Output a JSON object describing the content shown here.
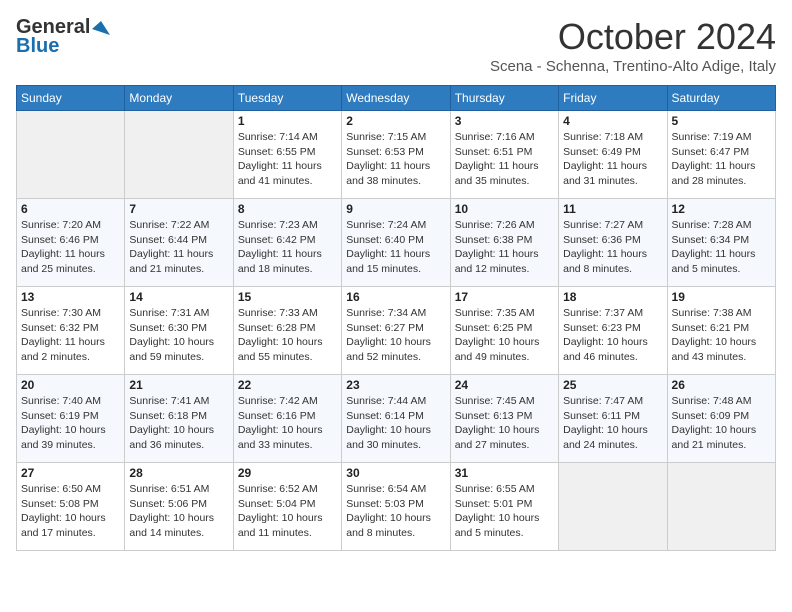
{
  "header": {
    "logo_general": "General",
    "logo_blue": "Blue",
    "month_title": "October 2024",
    "location": "Scena - Schenna, Trentino-Alto Adige, Italy"
  },
  "weekdays": [
    "Sunday",
    "Monday",
    "Tuesday",
    "Wednesday",
    "Thursday",
    "Friday",
    "Saturday"
  ],
  "weeks": [
    [
      {
        "day": "",
        "info": ""
      },
      {
        "day": "",
        "info": ""
      },
      {
        "day": "1",
        "info": "Sunrise: 7:14 AM\nSunset: 6:55 PM\nDaylight: 11 hours and 41 minutes."
      },
      {
        "day": "2",
        "info": "Sunrise: 7:15 AM\nSunset: 6:53 PM\nDaylight: 11 hours and 38 minutes."
      },
      {
        "day": "3",
        "info": "Sunrise: 7:16 AM\nSunset: 6:51 PM\nDaylight: 11 hours and 35 minutes."
      },
      {
        "day": "4",
        "info": "Sunrise: 7:18 AM\nSunset: 6:49 PM\nDaylight: 11 hours and 31 minutes."
      },
      {
        "day": "5",
        "info": "Sunrise: 7:19 AM\nSunset: 6:47 PM\nDaylight: 11 hours and 28 minutes."
      }
    ],
    [
      {
        "day": "6",
        "info": "Sunrise: 7:20 AM\nSunset: 6:46 PM\nDaylight: 11 hours and 25 minutes."
      },
      {
        "day": "7",
        "info": "Sunrise: 7:22 AM\nSunset: 6:44 PM\nDaylight: 11 hours and 21 minutes."
      },
      {
        "day": "8",
        "info": "Sunrise: 7:23 AM\nSunset: 6:42 PM\nDaylight: 11 hours and 18 minutes."
      },
      {
        "day": "9",
        "info": "Sunrise: 7:24 AM\nSunset: 6:40 PM\nDaylight: 11 hours and 15 minutes."
      },
      {
        "day": "10",
        "info": "Sunrise: 7:26 AM\nSunset: 6:38 PM\nDaylight: 11 hours and 12 minutes."
      },
      {
        "day": "11",
        "info": "Sunrise: 7:27 AM\nSunset: 6:36 PM\nDaylight: 11 hours and 8 minutes."
      },
      {
        "day": "12",
        "info": "Sunrise: 7:28 AM\nSunset: 6:34 PM\nDaylight: 11 hours and 5 minutes."
      }
    ],
    [
      {
        "day": "13",
        "info": "Sunrise: 7:30 AM\nSunset: 6:32 PM\nDaylight: 11 hours and 2 minutes."
      },
      {
        "day": "14",
        "info": "Sunrise: 7:31 AM\nSunset: 6:30 PM\nDaylight: 10 hours and 59 minutes."
      },
      {
        "day": "15",
        "info": "Sunrise: 7:33 AM\nSunset: 6:28 PM\nDaylight: 10 hours and 55 minutes."
      },
      {
        "day": "16",
        "info": "Sunrise: 7:34 AM\nSunset: 6:27 PM\nDaylight: 10 hours and 52 minutes."
      },
      {
        "day": "17",
        "info": "Sunrise: 7:35 AM\nSunset: 6:25 PM\nDaylight: 10 hours and 49 minutes."
      },
      {
        "day": "18",
        "info": "Sunrise: 7:37 AM\nSunset: 6:23 PM\nDaylight: 10 hours and 46 minutes."
      },
      {
        "day": "19",
        "info": "Sunrise: 7:38 AM\nSunset: 6:21 PM\nDaylight: 10 hours and 43 minutes."
      }
    ],
    [
      {
        "day": "20",
        "info": "Sunrise: 7:40 AM\nSunset: 6:19 PM\nDaylight: 10 hours and 39 minutes."
      },
      {
        "day": "21",
        "info": "Sunrise: 7:41 AM\nSunset: 6:18 PM\nDaylight: 10 hours and 36 minutes."
      },
      {
        "day": "22",
        "info": "Sunrise: 7:42 AM\nSunset: 6:16 PM\nDaylight: 10 hours and 33 minutes."
      },
      {
        "day": "23",
        "info": "Sunrise: 7:44 AM\nSunset: 6:14 PM\nDaylight: 10 hours and 30 minutes."
      },
      {
        "day": "24",
        "info": "Sunrise: 7:45 AM\nSunset: 6:13 PM\nDaylight: 10 hours and 27 minutes."
      },
      {
        "day": "25",
        "info": "Sunrise: 7:47 AM\nSunset: 6:11 PM\nDaylight: 10 hours and 24 minutes."
      },
      {
        "day": "26",
        "info": "Sunrise: 7:48 AM\nSunset: 6:09 PM\nDaylight: 10 hours and 21 minutes."
      }
    ],
    [
      {
        "day": "27",
        "info": "Sunrise: 6:50 AM\nSunset: 5:08 PM\nDaylight: 10 hours and 17 minutes."
      },
      {
        "day": "28",
        "info": "Sunrise: 6:51 AM\nSunset: 5:06 PM\nDaylight: 10 hours and 14 minutes."
      },
      {
        "day": "29",
        "info": "Sunrise: 6:52 AM\nSunset: 5:04 PM\nDaylight: 10 hours and 11 minutes."
      },
      {
        "day": "30",
        "info": "Sunrise: 6:54 AM\nSunset: 5:03 PM\nDaylight: 10 hours and 8 minutes."
      },
      {
        "day": "31",
        "info": "Sunrise: 6:55 AM\nSunset: 5:01 PM\nDaylight: 10 hours and 5 minutes."
      },
      {
        "day": "",
        "info": ""
      },
      {
        "day": "",
        "info": ""
      }
    ]
  ]
}
